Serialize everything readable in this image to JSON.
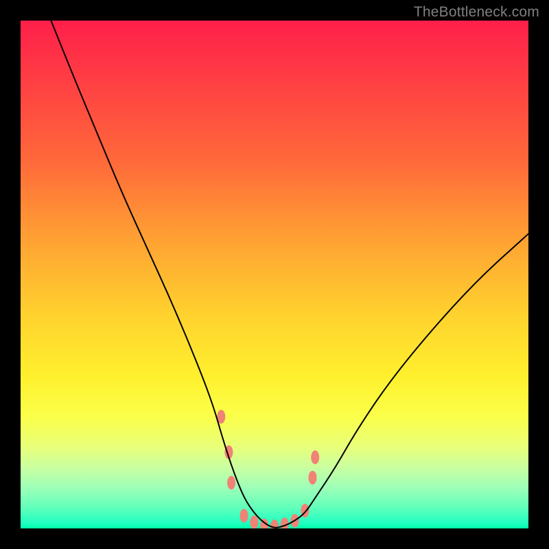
{
  "watermark": {
    "text": "TheBottleneck.com"
  },
  "chart_data": {
    "type": "line",
    "title": "",
    "xlabel": "",
    "ylabel": "",
    "xlim": [
      0,
      100
    ],
    "ylim": [
      0,
      100
    ],
    "grid": false,
    "legend": false,
    "background_gradient": {
      "direction": "vertical",
      "stops": [
        {
          "pos": 0,
          "color": "#ff1f4a"
        },
        {
          "pos": 28,
          "color": "#ff6a3a"
        },
        {
          "pos": 58,
          "color": "#ffd22e"
        },
        {
          "pos": 78,
          "color": "#fbff4a"
        },
        {
          "pos": 92,
          "color": "#9dffb8"
        },
        {
          "pos": 100,
          "color": "#00ffa8"
        }
      ]
    },
    "series": [
      {
        "name": "bottleneck-curve",
        "color": "#000000",
        "stroke_width": 2,
        "x": [
          6,
          10,
          15,
          20,
          25,
          30,
          35,
          38,
          40,
          42,
          44,
          46,
          48,
          50,
          52,
          54,
          56,
          58,
          62,
          66,
          72,
          80,
          90,
          100
        ],
        "values": [
          100,
          90,
          78,
          66,
          55,
          44,
          32,
          24,
          17,
          11,
          6,
          3,
          1,
          0,
          0.5,
          1.5,
          3,
          6,
          12,
          19,
          28,
          38,
          49,
          58
        ]
      }
    ],
    "markers": {
      "name": "valley-markers",
      "color": "#f08276",
      "shape": "oval",
      "rx": 6,
      "ry": 10,
      "points": [
        {
          "x": 39.5,
          "y": 22
        },
        {
          "x": 41,
          "y": 15
        },
        {
          "x": 41.5,
          "y": 9
        },
        {
          "x": 44,
          "y": 2.5
        },
        {
          "x": 46,
          "y": 1.2
        },
        {
          "x": 48,
          "y": 0.6
        },
        {
          "x": 50,
          "y": 0.4
        },
        {
          "x": 52,
          "y": 0.8
        },
        {
          "x": 54,
          "y": 1.5
        },
        {
          "x": 56,
          "y": 3.5
        },
        {
          "x": 57.5,
          "y": 10
        },
        {
          "x": 58,
          "y": 14
        }
      ]
    }
  }
}
